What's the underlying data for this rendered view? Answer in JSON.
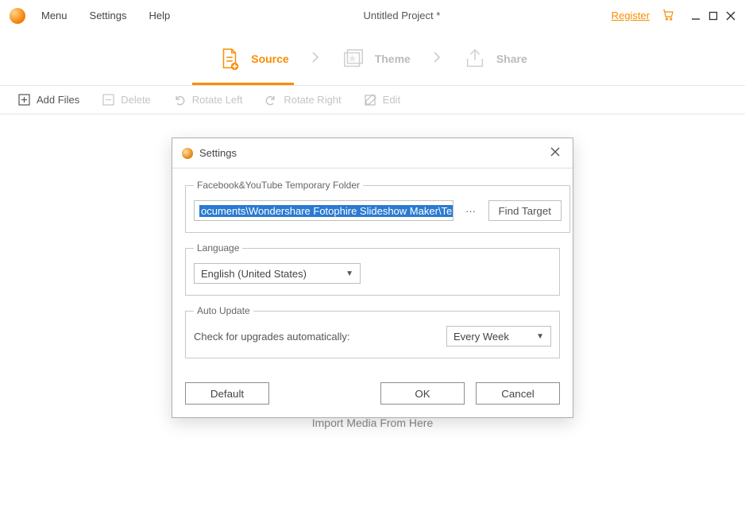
{
  "menubar": {
    "menu": "Menu",
    "settings": "Settings",
    "help": "Help",
    "title": "Untitled Project *",
    "register": "Register"
  },
  "stepper": {
    "source": "Source",
    "theme": "Theme",
    "share": "Share"
  },
  "toolbar": {
    "addFiles": "Add Files",
    "delete": "Delete",
    "rotateLeft": "Rotate Left",
    "rotateRight": "Rotate Right",
    "edit": "Edit"
  },
  "main": {
    "importHint": "Import Media From Here"
  },
  "dialog": {
    "title": "Settings",
    "groups": {
      "folder": {
        "legend": "Facebook&YouTube Temporary Folder",
        "path": "ocuments\\Wondershare Fotophire Slideshow Maker\\Temp\\",
        "more": "···",
        "findTarget": "Find Target"
      },
      "language": {
        "legend": "Language",
        "value": "English (United States)"
      },
      "autoUpdate": {
        "legend": "Auto Update",
        "label": "Check for upgrades automatically:",
        "value": "Every Week"
      }
    },
    "buttons": {
      "default": "Default",
      "ok": "OK",
      "cancel": "Cancel"
    }
  }
}
